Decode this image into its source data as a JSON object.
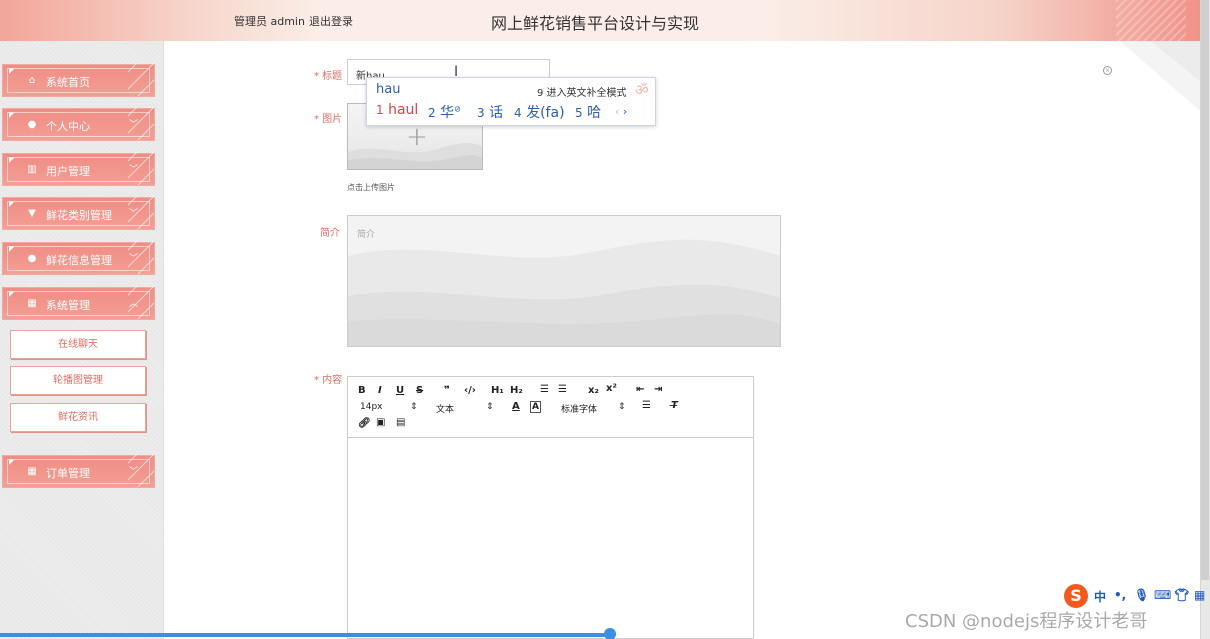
{
  "header": {
    "admin_text": "管理员 admin",
    "logout_label": "退出登录",
    "title": "网上鲜花销售平台设计与实现"
  },
  "sidebar": {
    "items": [
      {
        "label": "系统首页",
        "icon": "home-icon",
        "has_chevron": false
      },
      {
        "label": "个人中心",
        "icon": "user-icon",
        "has_chevron": true
      },
      {
        "label": "用户管理",
        "icon": "book-icon",
        "has_chevron": true
      },
      {
        "label": "鲜花类别管理",
        "icon": "flag-icon",
        "has_chevron": true
      },
      {
        "label": "鲜花信息管理",
        "icon": "user-icon",
        "has_chevron": true
      },
      {
        "label": "系统管理",
        "icon": "grid-icon",
        "has_chevron": true
      },
      {
        "label": "订单管理",
        "icon": "grid-icon",
        "has_chevron": true
      }
    ],
    "sub_items": [
      "在线聊天",
      "轮播图管理",
      "鲜花资讯"
    ]
  },
  "form": {
    "title_label": "* 标题",
    "title_value": "新hau",
    "image_label": "* 图片",
    "upload_hint": "点击上传图片",
    "intro_label": "简介",
    "intro_placeholder": "简介",
    "content_label": "* 内容"
  },
  "editor": {
    "font_size": "14px",
    "text_type": "文本",
    "font_family": "标准字体"
  },
  "ime": {
    "typed": "hau",
    "hint": "9 进入英文补全模式",
    "candidates": [
      {
        "num": "1",
        "text": "haul"
      },
      {
        "num": "2",
        "text": "华"
      },
      {
        "num": "3",
        "text": "话"
      },
      {
        "num": "4",
        "text": "发(fa)"
      },
      {
        "num": "5",
        "text": "哈"
      }
    ]
  },
  "sogou_bar": {
    "logo": "S",
    "lang": "中"
  },
  "watermark": "CSDN @nodejs程序设计老哥",
  "colors": {
    "accent": "#f08d84",
    "label_red": "#e26d63",
    "ime_blue": "#2c5fad"
  }
}
